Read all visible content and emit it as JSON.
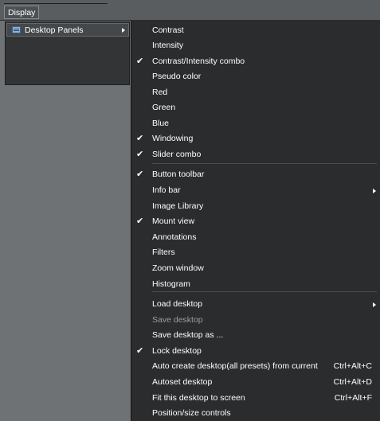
{
  "menubar": {
    "display_label": "Display"
  },
  "submenu": {
    "label": "Desktop Panels"
  },
  "menu": {
    "items": [
      {
        "label": "Contrast",
        "checked": false
      },
      {
        "label": "Intensity",
        "checked": false
      },
      {
        "label": "Contrast/Intensity combo",
        "checked": true
      },
      {
        "label": "Pseudo color",
        "checked": false
      },
      {
        "label": "Red",
        "checked": false
      },
      {
        "label": "Green",
        "checked": false
      },
      {
        "label": "Blue",
        "checked": false
      },
      {
        "label": "Windowing",
        "checked": true
      },
      {
        "label": "Slider combo",
        "checked": true
      },
      {
        "label": "Button toolbar",
        "checked": true
      },
      {
        "label": "Info bar",
        "checked": false,
        "submenu": true
      },
      {
        "label": "Image Library",
        "checked": false
      },
      {
        "label": "Mount view",
        "checked": true
      },
      {
        "label": "Annotations",
        "checked": false
      },
      {
        "label": "Filters",
        "checked": false
      },
      {
        "label": "Zoom window",
        "checked": false
      },
      {
        "label": "Histogram",
        "checked": false
      },
      {
        "label": "Load desktop",
        "checked": false,
        "submenu": true
      },
      {
        "label": "Save desktop",
        "checked": false,
        "disabled": true
      },
      {
        "label": "Save desktop as ...",
        "checked": false
      },
      {
        "label": "Lock desktop",
        "checked": true
      },
      {
        "label": "Auto create desktop(all presets) from current",
        "checked": false,
        "shortcut": "Ctrl+Alt+C"
      },
      {
        "label": "Autoset desktop",
        "checked": false,
        "shortcut": "Ctrl+Alt+D"
      },
      {
        "label": "Fit this desktop to screen",
        "checked": false,
        "shortcut": "Ctrl+Alt+F"
      },
      {
        "label": "Position/size controls",
        "checked": false
      }
    ]
  }
}
